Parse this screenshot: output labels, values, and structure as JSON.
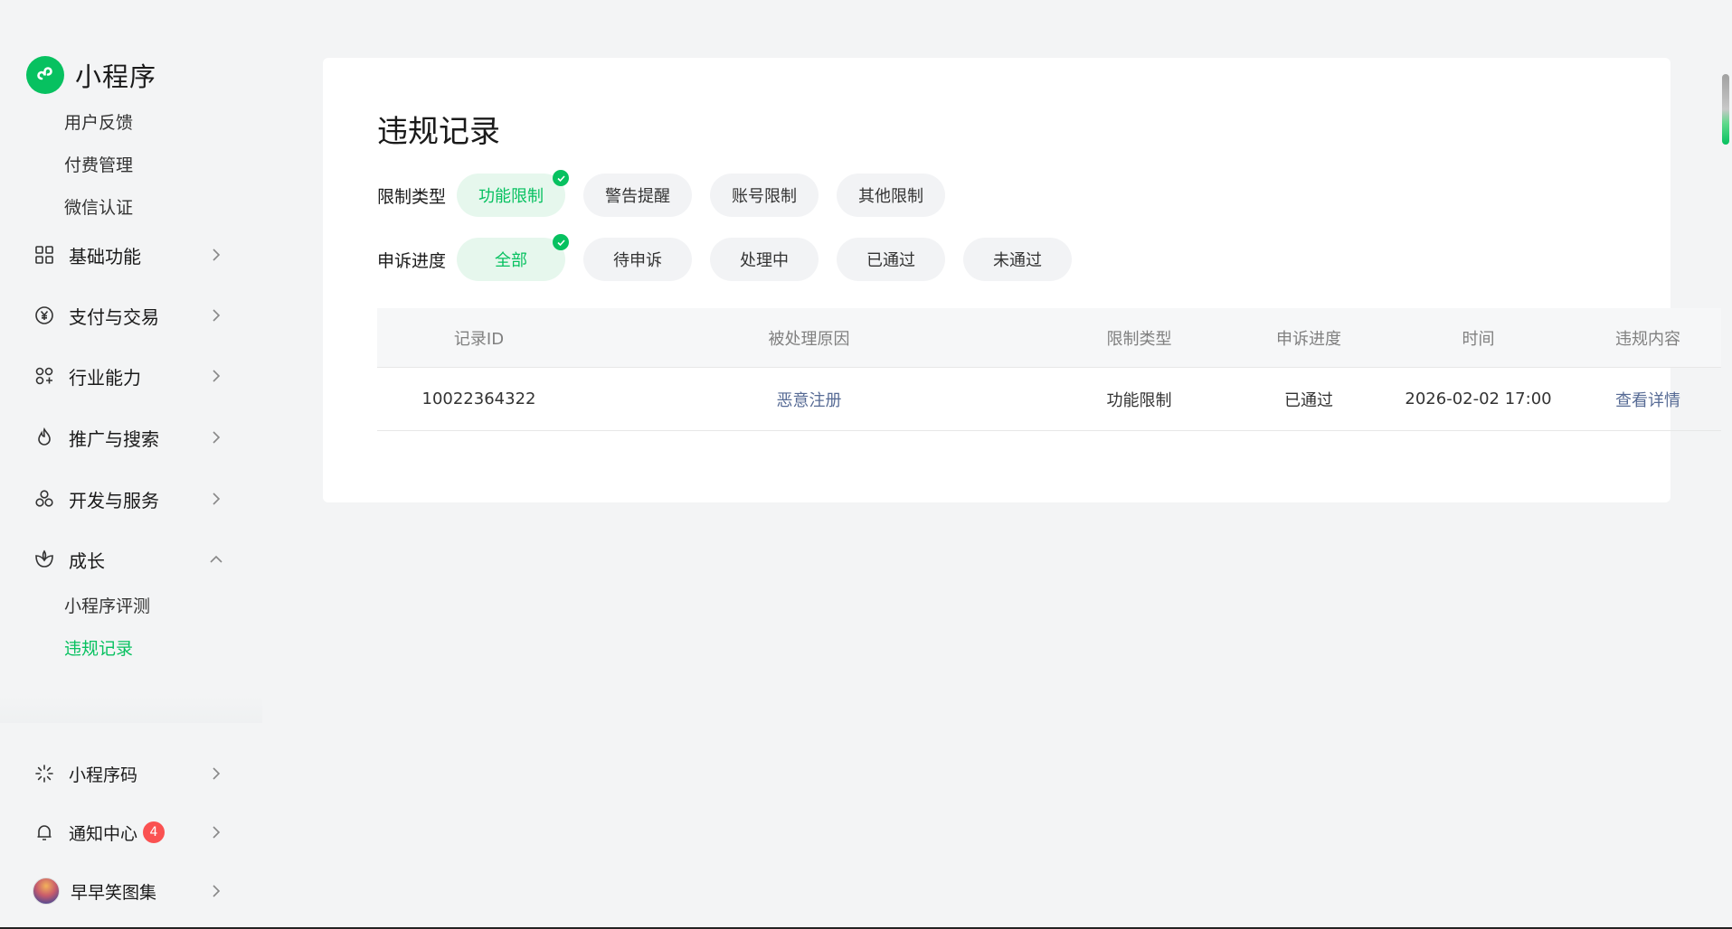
{
  "brand": {
    "name": "小程序",
    "logo_icon": "miniprogram-logo-icon",
    "accent": "#07c160"
  },
  "sidebar": {
    "top_subitems": [
      {
        "label": "用户反馈"
      },
      {
        "label": "付费管理"
      },
      {
        "label": "微信认证"
      }
    ],
    "sections": [
      {
        "label": "基础功能",
        "icon": "grid-icon",
        "expanded": false
      },
      {
        "label": "支付与交易",
        "icon": "yen-circle-icon",
        "expanded": false
      },
      {
        "label": "行业能力",
        "icon": "industry-icon",
        "expanded": false
      },
      {
        "label": "推广与搜索",
        "icon": "flame-icon",
        "expanded": false
      },
      {
        "label": "开发与服务",
        "icon": "dev-service-icon",
        "expanded": false
      },
      {
        "label": "成长",
        "icon": "growth-icon",
        "expanded": true
      }
    ],
    "growth_subitems": [
      {
        "label": "小程序评测",
        "active": false
      },
      {
        "label": "违规记录",
        "active": true
      }
    ],
    "bottom_items": [
      {
        "label": "小程序码",
        "icon": "qrcode-sun-icon"
      },
      {
        "label": "通知中心",
        "icon": "bell-icon",
        "badge": "4"
      },
      {
        "label": "早早笑图集",
        "icon": "avatar"
      }
    ]
  },
  "main": {
    "title": "违规记录",
    "filters": {
      "restriction_type": {
        "label": "限制类型",
        "options": [
          "功能限制",
          "警告提醒",
          "账号限制",
          "其他限制"
        ],
        "selected": "功能限制"
      },
      "appeal_progress": {
        "label": "申诉进度",
        "options": [
          "全部",
          "待申诉",
          "处理中",
          "已通过",
          "未通过"
        ],
        "selected": "全部"
      }
    },
    "table": {
      "columns": [
        "记录ID",
        "被处理原因",
        "限制类型",
        "申诉进度",
        "时间",
        "违规内容"
      ],
      "rows": [
        {
          "record_id": "10022364322",
          "reason": "恶意注册",
          "restriction_type": "功能限制",
          "appeal_progress": "已通过",
          "time": "2026-02-02 17:00",
          "content": "查看详情"
        }
      ]
    }
  }
}
